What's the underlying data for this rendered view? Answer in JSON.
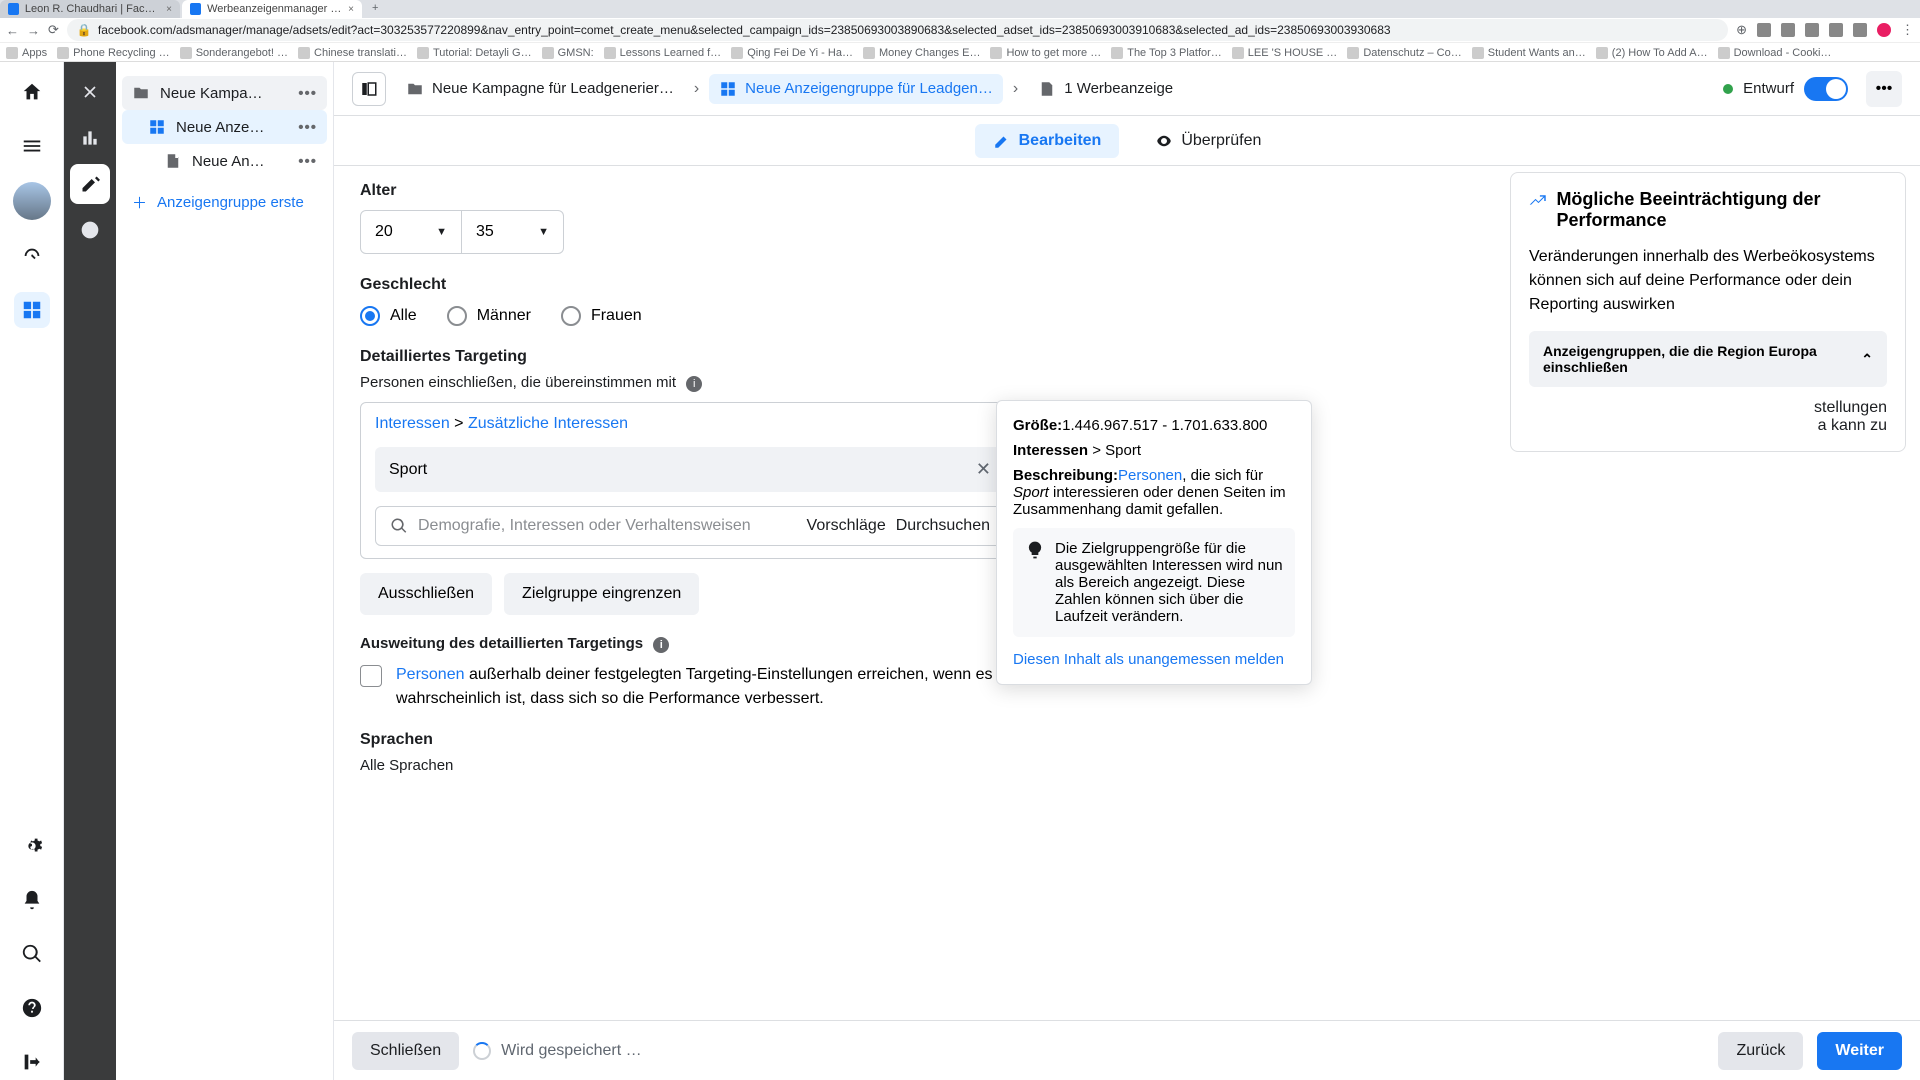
{
  "browser": {
    "tabs": [
      {
        "title": "Leon R. Chaudhari | Facebook",
        "close": "×"
      },
      {
        "title": "Werbeanzeigenmanager - We",
        "close": "×"
      }
    ],
    "url": "facebook.com/adsmanager/manage/adsets/edit?act=303253577220899&nav_entry_point=comet_create_menu&selected_campaign_ids=23850693003890683&selected_adset_ids=23850693003910683&selected_ad_ids=23850693003930683",
    "bookmarks": [
      "Apps",
      "Phone Recycling …",
      "Sonderangebot! …",
      "Chinese translati…",
      "Tutorial: Detayli G…",
      "GMSN:",
      "Lessons Learned f…",
      "Qing Fei De Yi - Ha…",
      "Money Changes E…",
      "How to get more …",
      "The Top 3 Platfor…",
      "LEE 'S HOUSE …",
      "Datenschutz – Co…",
      "Student Wants an…",
      "(2) How To Add A…",
      "Download - Cooki…"
    ]
  },
  "tree": {
    "campaign": "Neue Kampa…",
    "adset": "Neue Anze…",
    "ad": "Neue An…",
    "addGroup": "Anzeigengruppe erste"
  },
  "crumbs": {
    "campaign": "Neue Kampagne für Leadgenerier…",
    "adset": "Neue Anzeigengruppe für Leadgen…",
    "ad": "1 Werbeanzeige",
    "status": "Entwurf"
  },
  "modes": {
    "edit": "Bearbeiten",
    "review": "Überprüfen"
  },
  "form": {
    "age_label": "Alter",
    "age_min": "20",
    "age_max": "35",
    "gender_label": "Geschlecht",
    "g_all": "Alle",
    "g_m": "Männer",
    "g_f": "Frauen",
    "dt_label": "Detailliertes Targeting",
    "dt_sub": "Personen einschließen, die übereinstimmen mit",
    "path1": "Interessen",
    "path_sep": ">",
    "path2": "Zusätzliche Interessen",
    "chip": "Sport",
    "search_ph": "Demografie, Interessen oder Verhaltensweisen",
    "suggest": "Vorschläge",
    "browse": "Durchsuchen",
    "exclude": "Ausschließen",
    "narrow": "Zielgruppe eingrenzen",
    "expand_label": "Ausweitung des detaillierten Targetings",
    "expand_link": "Personen",
    "expand_text": " außerhalb deiner festgelegten Targeting-Einstellungen erreichen, wenn es wahrscheinlich ist, dass sich so die Performance verbessert.",
    "lang_label": "Sprachen",
    "lang_val": "Alle Sprachen"
  },
  "tooltip": {
    "size_k": "Größe:",
    "size_v": "1.446.967.517 - 1.701.633.800",
    "interest_k": "Interessen",
    "interest_sep": " > ",
    "interest_v": "Sport",
    "desc_k": "Beschreibung:",
    "desc_link": "Personen",
    "desc_mid": ", die sich für ",
    "desc_it": "Sport",
    "desc_rest": " interessieren oder denen Seiten im Zusammenhang damit gefallen.",
    "tip": "Die Zielgruppengröße für die ausgewählten Interessen wird nun als Bereich angezeigt. Diese Zahlen können sich über die Laufzeit verändern.",
    "report": "Diesen Inhalt als unangemessen melden"
  },
  "perf": {
    "title": "Mögliche Beeinträchtigung der Performance",
    "body": "Veränderungen innerhalb des Werbeökosystems können sich auf deine Performance oder dein Reporting auswirken",
    "acc": "Anzeigengruppen, die die Region Europa einschließen",
    "peek1": "stellungen",
    "peek2": "a kann zu"
  },
  "footer": {
    "close": "Schließen",
    "saving": "Wird gespeichert …",
    "back": "Zurück",
    "next": "Weiter"
  }
}
